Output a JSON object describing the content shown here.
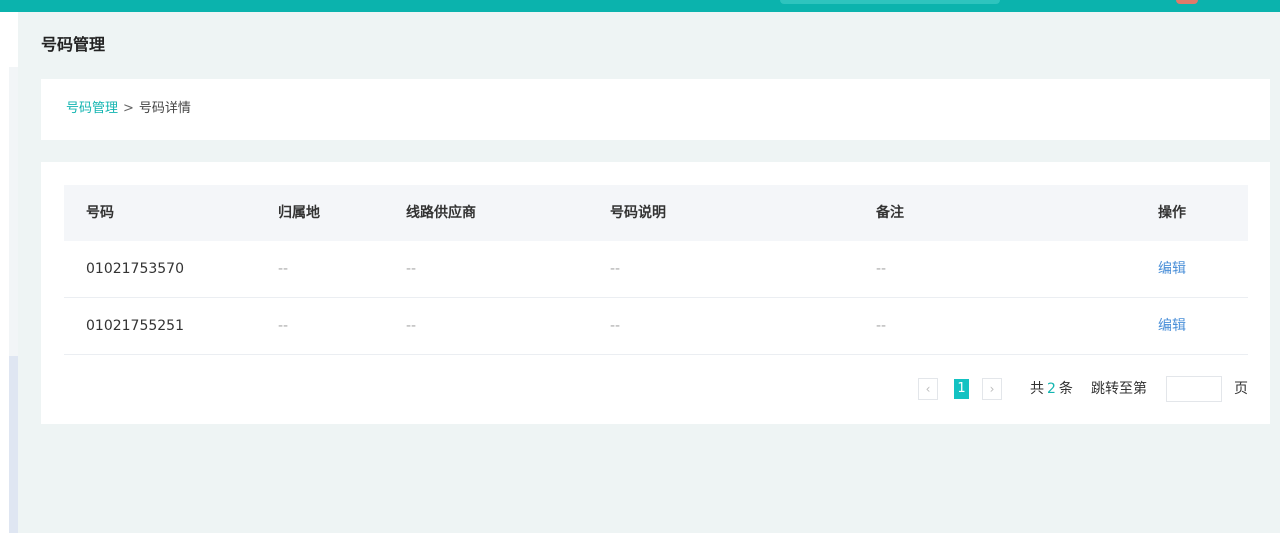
{
  "page": {
    "title": "号码管理"
  },
  "breadcrumb": {
    "parent": "号码管理",
    "separator": ">",
    "current": "号码详情"
  },
  "table": {
    "headers": [
      "号码",
      "归属地",
      "线路供应商",
      "号码说明",
      "备注",
      "操作"
    ],
    "rows": [
      {
        "number": "01021753570",
        "location": "--",
        "provider": "--",
        "description": "--",
        "remark": "--",
        "action": "编辑"
      },
      {
        "number": "01021755251",
        "location": "--",
        "provider": "--",
        "description": "--",
        "remark": "--",
        "action": "编辑"
      }
    ]
  },
  "pagination": {
    "prev": "‹",
    "current_page": "1",
    "next": "›",
    "total_prefix": "共",
    "total": "2",
    "total_suffix": "条",
    "jump_label": "跳转至第",
    "jump_value": "",
    "page_unit": "页"
  },
  "colors": {
    "accent": "#13c2c2",
    "topbar": "#0bb3ad",
    "link": "#4a8fd8"
  }
}
